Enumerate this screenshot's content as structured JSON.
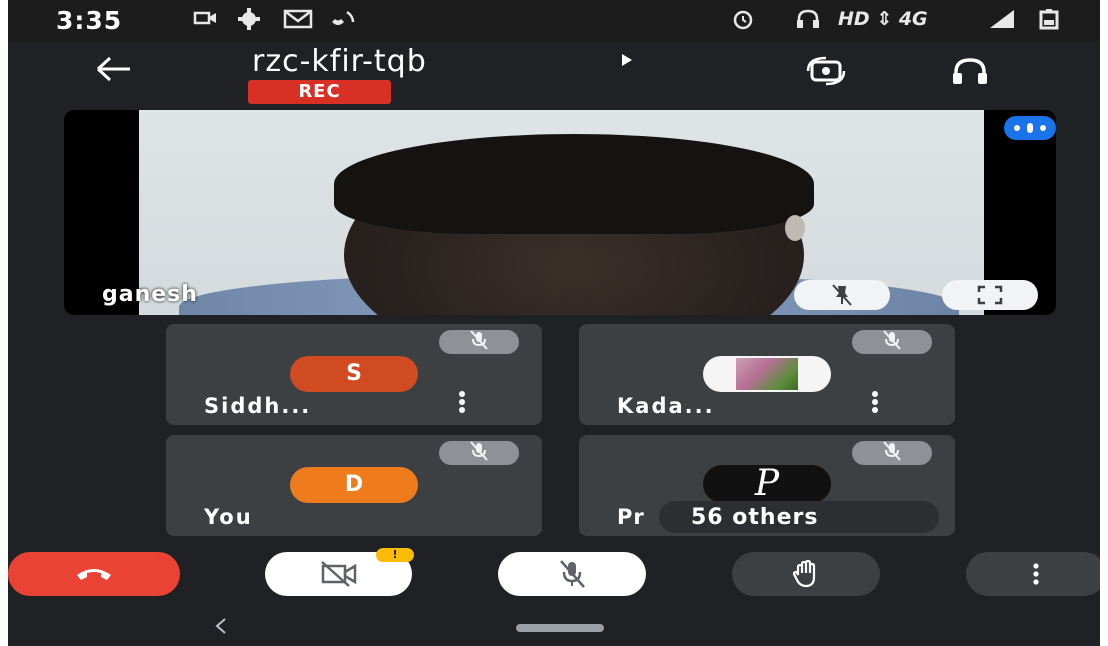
{
  "status_bar": {
    "time": "3:35",
    "icons": [
      "video-icon",
      "gear-icon",
      "gmail-icon",
      "phone-wifi-icon",
      "alarm-icon",
      "headset-icon",
      "signal-icon",
      "battery-icon"
    ],
    "right_text": "HD ⇕ 4G"
  },
  "meeting": {
    "code": "rzc-kfir-tqb",
    "rec_label": "REC"
  },
  "main_video": {
    "name": "ganesh"
  },
  "participants": [
    {
      "name": "Siddh...",
      "initial": "S",
      "avatar_color": "#d04a22"
    },
    {
      "name": "Kada...",
      "initial": "",
      "avatar_color": "#f5f5f5"
    },
    {
      "name": "You",
      "initial": "D",
      "avatar_color": "#ef7c1c"
    },
    {
      "name": "Pr",
      "initial": "P",
      "avatar_color": "#111111"
    }
  ],
  "others": {
    "count_label": "56 others"
  },
  "controls": {
    "warning_badge": "!"
  },
  "colors": {
    "background": "#202124",
    "tile": "#3c4043",
    "end_call": "#ea4335",
    "rec": "#d93025",
    "accent_blue": "#1a73e8",
    "warning": "#fbbc04"
  }
}
